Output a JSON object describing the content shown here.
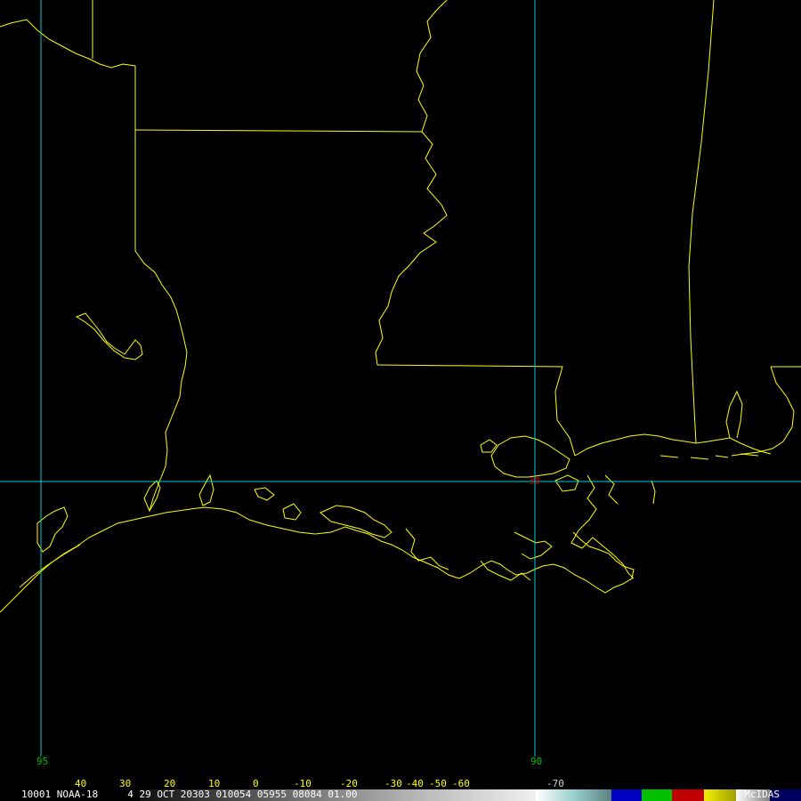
{
  "map": {
    "boundary_color": "#ffff00",
    "grid_color": "#00d0d0",
    "lon_label_color": "#00c000",
    "lat_label_color": "#c00000",
    "lon_labels": [
      "95",
      "90"
    ],
    "lat_labels": [
      "30"
    ]
  },
  "colorbar": {
    "ticks": [
      "40",
      "30",
      "20",
      "10",
      "0",
      "-10",
      "-20",
      "-30",
      "-40",
      "-50",
      "-60",
      "-70"
    ],
    "info": "10001 NOAA-18     4 29 OCT 20303 010054 05955 08084 01.00",
    "brand": "McIDAS"
  }
}
